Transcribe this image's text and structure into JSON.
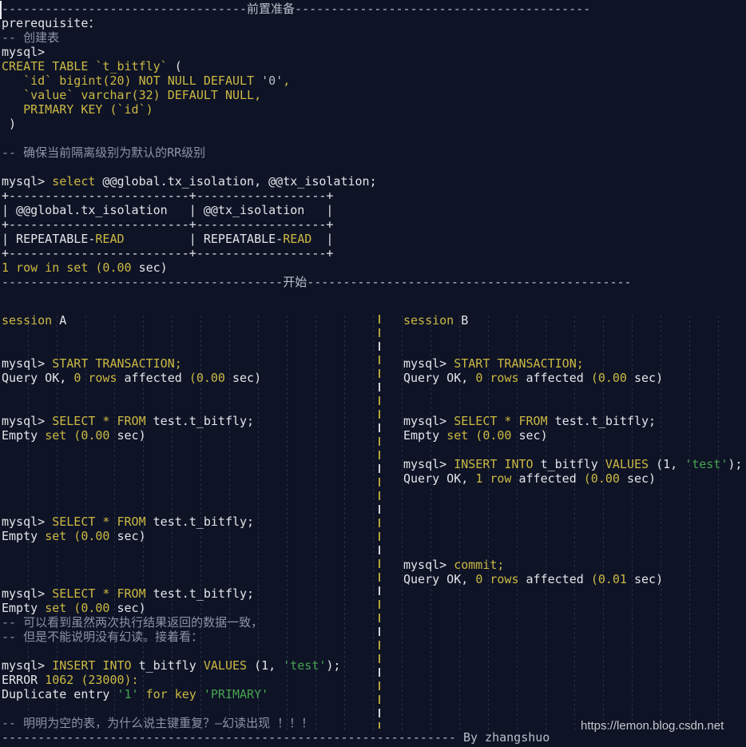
{
  "palette": {
    "background": "#0e1326",
    "text_white": "#e3e5e8",
    "keyword_yellow": "#ccb942",
    "string_green": "#46a34f",
    "comment_gray": "#8d94a6",
    "line_gray": "#b9bfc9",
    "separator_yellow": "#b3a23c"
  },
  "top_section": {
    "lines": [
      {
        "segs": [
          {
            "t": "----------------------------------前置准备-----------------------------------------",
            "c": "d"
          }
        ]
      },
      {
        "segs": [
          {
            "t": "prerequisite：",
            "c": "w"
          }
        ]
      },
      {
        "segs": [
          {
            "t": "-- 创建表",
            "c": "c"
          }
        ]
      },
      {
        "segs": [
          {
            "t": "mysql>",
            "c": "w"
          }
        ]
      },
      {
        "segs": [
          {
            "t": "CREATE TABLE `t_bitfly`",
            "c": "y"
          },
          {
            "t": " (",
            "c": "w"
          }
        ]
      },
      {
        "segs": [
          {
            "t": "   `id` bigint(20) NOT NULL DEFAULT ",
            "c": "y"
          },
          {
            "t": "'0'",
            "c": "d"
          },
          {
            "t": ",",
            "c": "y"
          }
        ]
      },
      {
        "segs": [
          {
            "t": "   `value` varchar(32) DEFAULT NULL,",
            "c": "y"
          }
        ]
      },
      {
        "segs": [
          {
            "t": "   PRIMARY KEY (`id`)",
            "c": "y"
          }
        ]
      },
      {
        "segs": [
          {
            "t": " )",
            "c": "w"
          }
        ]
      },
      {
        "segs": []
      },
      {
        "segs": [
          {
            "t": "-- 确保当前隔离级别为默认的RR级别",
            "c": "c"
          }
        ]
      },
      {
        "segs": []
      },
      {
        "segs": [
          {
            "t": "mysql> ",
            "c": "w"
          },
          {
            "t": "select",
            "c": "y"
          },
          {
            "t": " @@global.tx_isolation, @@tx_isolation;",
            "c": "w"
          }
        ]
      },
      {
        "segs": [
          {
            "t": "+-------------------------+------------------+",
            "c": "w"
          }
        ]
      },
      {
        "segs": [
          {
            "t": "| @@global.tx_isolation   | @@tx_isolation   |",
            "c": "w"
          }
        ]
      },
      {
        "segs": [
          {
            "t": "+-------------------------+------------------+",
            "c": "w"
          }
        ]
      },
      {
        "segs": [
          {
            "t": "| REPEATABLE-",
            "c": "w"
          },
          {
            "t": "READ",
            "c": "y"
          },
          {
            "t": "         | REPEATABLE-",
            "c": "w"
          },
          {
            "t": "READ",
            "c": "y"
          },
          {
            "t": "  |",
            "c": "w"
          }
        ]
      },
      {
        "segs": [
          {
            "t": "+-------------------------+------------------+",
            "c": "w"
          }
        ]
      },
      {
        "segs": [
          {
            "t": "1 row in set (0.00 ",
            "c": "y"
          },
          {
            "t": "sec)",
            "c": "w"
          }
        ]
      },
      {
        "segs": [
          {
            "t": "---------------------------------------开始---------------------------------------------",
            "c": "d"
          }
        ]
      }
    ]
  },
  "session_a": {
    "lines": [
      {
        "segs": [
          {
            "t": "session",
            "c": "y"
          },
          {
            "t": " A",
            "c": "w"
          }
        ]
      },
      {
        "segs": []
      },
      {
        "segs": []
      },
      {
        "segs": [
          {
            "t": "mysql> ",
            "c": "w"
          },
          {
            "t": "START TRANSACTION;",
            "c": "y"
          }
        ]
      },
      {
        "segs": [
          {
            "t": "Query OK, ",
            "c": "w"
          },
          {
            "t": "0 rows",
            "c": "y"
          },
          {
            "t": " affected ",
            "c": "w"
          },
          {
            "t": "(0.00 ",
            "c": "y"
          },
          {
            "t": "sec)",
            "c": "w"
          }
        ]
      },
      {
        "segs": []
      },
      {
        "segs": []
      },
      {
        "segs": [
          {
            "t": "mysql> ",
            "c": "w"
          },
          {
            "t": "SELECT * FROM",
            "c": "y"
          },
          {
            "t": " test.t_bitfly;",
            "c": "w"
          }
        ]
      },
      {
        "segs": [
          {
            "t": "Empty ",
            "c": "w"
          },
          {
            "t": "set (0.00 ",
            "c": "y"
          },
          {
            "t": "sec)",
            "c": "w"
          }
        ]
      },
      {
        "segs": []
      },
      {
        "segs": []
      },
      {
        "segs": []
      },
      {
        "segs": []
      },
      {
        "segs": []
      },
      {
        "segs": [
          {
            "t": "mysql> ",
            "c": "w"
          },
          {
            "t": "SELECT * FROM",
            "c": "y"
          },
          {
            "t": " test.t_bitfly;",
            "c": "w"
          }
        ]
      },
      {
        "segs": [
          {
            "t": "Empty ",
            "c": "w"
          },
          {
            "t": "set (0.00 ",
            "c": "y"
          },
          {
            "t": "sec)",
            "c": "w"
          }
        ]
      },
      {
        "segs": []
      },
      {
        "segs": []
      },
      {
        "segs": []
      },
      {
        "segs": [
          {
            "t": "mysql> ",
            "c": "w"
          },
          {
            "t": "SELECT * FROM",
            "c": "y"
          },
          {
            "t": " test.t_bitfly;",
            "c": "w"
          }
        ]
      },
      {
        "segs": [
          {
            "t": "Empty ",
            "c": "w"
          },
          {
            "t": "set (0.00 ",
            "c": "y"
          },
          {
            "t": "sec)",
            "c": "w"
          }
        ]
      },
      {
        "segs": [
          {
            "t": "-- 可以看到虽然两次执行结果返回的数据一致，",
            "c": "c"
          }
        ]
      },
      {
        "segs": [
          {
            "t": "-- 但是不能说明没有幻读。接着看：",
            "c": "c"
          }
        ]
      },
      {
        "segs": []
      },
      {
        "segs": [
          {
            "t": "mysql> ",
            "c": "w"
          },
          {
            "t": "INSERT INTO",
            "c": "y"
          },
          {
            "t": " t_bitfly ",
            "c": "w"
          },
          {
            "t": "VALUES",
            "c": "y"
          },
          {
            "t": " (1, ",
            "c": "w"
          },
          {
            "t": "'test'",
            "c": "g"
          },
          {
            "t": ");",
            "c": "w"
          }
        ]
      },
      {
        "segs": [
          {
            "t": "ERROR ",
            "c": "w"
          },
          {
            "t": "1062 (23000):",
            "c": "y"
          }
        ]
      },
      {
        "segs": [
          {
            "t": "Duplicate entry ",
            "c": "w"
          },
          {
            "t": "'1'",
            "c": "g"
          },
          {
            "t": " for key ",
            "c": "y"
          },
          {
            "t": "'PRIMARY'",
            "c": "g"
          }
        ]
      },
      {
        "segs": []
      },
      {
        "segs": [
          {
            "t": "-- 明明为空的表，为什么说主键重复？—幻读出现 ！！！",
            "c": "c"
          }
        ]
      }
    ]
  },
  "session_b": {
    "lines": [
      {
        "segs": [
          {
            "t": "session",
            "c": "y"
          },
          {
            "t": " B",
            "c": "w"
          }
        ]
      },
      {
        "segs": []
      },
      {
        "segs": []
      },
      {
        "segs": [
          {
            "t": "mysql> ",
            "c": "w"
          },
          {
            "t": "START TRANSACTION;",
            "c": "y"
          }
        ]
      },
      {
        "segs": [
          {
            "t": "Query OK, ",
            "c": "w"
          },
          {
            "t": "0 rows",
            "c": "y"
          },
          {
            "t": " affected ",
            "c": "w"
          },
          {
            "t": "(0.00 ",
            "c": "y"
          },
          {
            "t": "sec)",
            "c": "w"
          }
        ]
      },
      {
        "segs": []
      },
      {
        "segs": []
      },
      {
        "segs": [
          {
            "t": "mysql> ",
            "c": "w"
          },
          {
            "t": "SELECT * FROM",
            "c": "y"
          },
          {
            "t": " test.t_bitfly;",
            "c": "w"
          }
        ]
      },
      {
        "segs": [
          {
            "t": "Empty ",
            "c": "w"
          },
          {
            "t": "set (0.00 ",
            "c": "y"
          },
          {
            "t": "sec)",
            "c": "w"
          }
        ]
      },
      {
        "segs": []
      },
      {
        "segs": [
          {
            "t": "mysql> ",
            "c": "w"
          },
          {
            "t": "INSERT INTO",
            "c": "y"
          },
          {
            "t": " t_bitfly ",
            "c": "w"
          },
          {
            "t": "VALUES",
            "c": "y"
          },
          {
            "t": " (1, ",
            "c": "w"
          },
          {
            "t": "'test'",
            "c": "g"
          },
          {
            "t": ");",
            "c": "w"
          }
        ]
      },
      {
        "segs": [
          {
            "t": "Query OK, ",
            "c": "w"
          },
          {
            "t": "1 row",
            "c": "y"
          },
          {
            "t": " affected ",
            "c": "w"
          },
          {
            "t": "(0.00 ",
            "c": "y"
          },
          {
            "t": "sec)",
            "c": "w"
          }
        ]
      },
      {
        "segs": []
      },
      {
        "segs": []
      },
      {
        "segs": []
      },
      {
        "segs": []
      },
      {
        "segs": []
      },
      {
        "segs": [
          {
            "t": "mysql> ",
            "c": "w"
          },
          {
            "t": "commit;",
            "c": "y"
          }
        ]
      },
      {
        "segs": [
          {
            "t": "Query OK, ",
            "c": "w"
          },
          {
            "t": "0 rows",
            "c": "y"
          },
          {
            "t": " affected ",
            "c": "w"
          },
          {
            "t": "(0.01 ",
            "c": "y"
          },
          {
            "t": "sec)",
            "c": "w"
          }
        ]
      }
    ]
  },
  "footer": {
    "lines": [
      {
        "segs": [
          {
            "t": "--------------------------------------------------------------- By zhangshuo",
            "c": "d"
          }
        ]
      }
    ]
  },
  "watermark": {
    "text": "https://lemon.blog.csdn.net"
  }
}
